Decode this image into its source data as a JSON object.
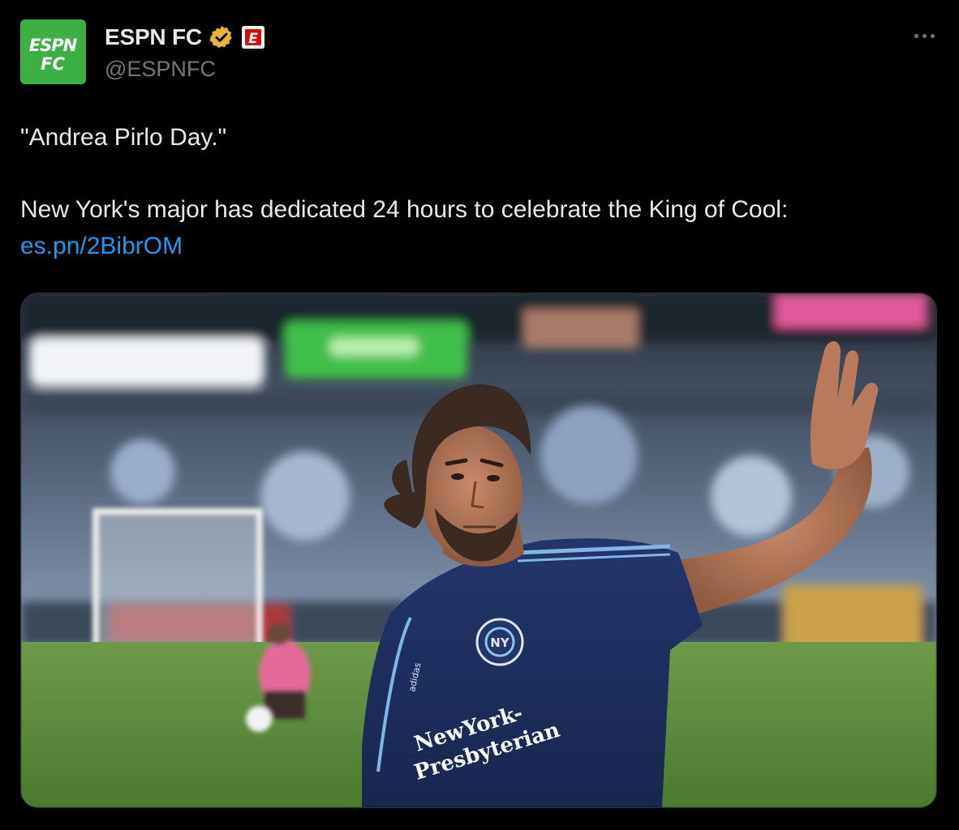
{
  "account": {
    "display_name": "ESPN FC",
    "handle": "@ESPNFC",
    "avatar_text_top": "ESPN",
    "avatar_text_bottom": "FC",
    "avatar_color": "#3cb043",
    "verified_badge_color": "#e8b32f",
    "affiliate_badge_letter": "E",
    "affiliate_badge_color": "#d50a0a"
  },
  "tweet": {
    "line1": "\"Andrea Pirlo Day.\"",
    "line2": "New York's major has dedicated 24 hours to celebrate the King of Cool:",
    "link_text": "es.pn/2BibrOM",
    "link_color": "#1d9bf0"
  },
  "media": {
    "jersey_sponsor_line1": "NewYork-",
    "jersey_sponsor_line2": "Presbyterian",
    "jersey_brand": "adidas"
  },
  "icons": {
    "more": "more-horizontal-icon",
    "verified": "verified-badge-icon",
    "affiliate": "espn-affiliate-badge-icon"
  }
}
